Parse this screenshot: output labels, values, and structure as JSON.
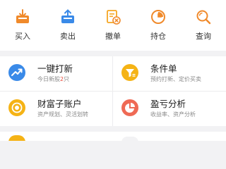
{
  "colors": {
    "accent_orange": "#f08a2b",
    "accent_blue": "#3a8ae8",
    "accent_yellow": "#f5b315",
    "accent_red": "#ef6a55",
    "highlight_red": "#e94b3c"
  },
  "quick_actions": [
    {
      "label": "买入",
      "icon": "buy-tray-icon"
    },
    {
      "label": "卖出",
      "icon": "sell-tray-icon"
    },
    {
      "label": "撤单",
      "icon": "cancel-order-icon"
    },
    {
      "label": "持仓",
      "icon": "position-pie-icon"
    },
    {
      "label": "查询",
      "icon": "search-icon"
    }
  ],
  "features": [
    {
      "title": "一键打新",
      "sub_prefix": "今日新股",
      "sub_count": "2",
      "sub_suffix": "只",
      "icon": "trend-arrow-icon"
    },
    {
      "title": "条件单",
      "sub": "预约打新、定价买卖",
      "icon": "filter-funnel-icon"
    },
    {
      "title": "财富子账户",
      "sub": "资产规划、灵活划转",
      "icon": "coin-icon"
    },
    {
      "title": "盈亏分析",
      "sub": "收益率、资产分析",
      "icon": "pie-chart-icon"
    }
  ]
}
